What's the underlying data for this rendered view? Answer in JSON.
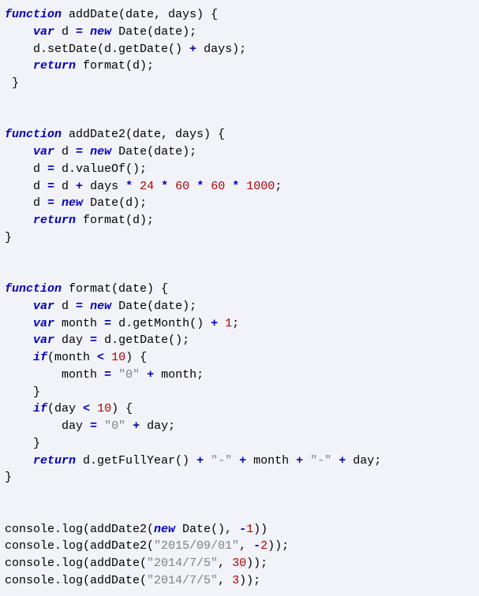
{
  "code": {
    "lines": [
      [
        {
          "t": "function",
          "c": "kw"
        },
        {
          "t": " addDate(date, days) {",
          "c": "id"
        }
      ],
      [
        {
          "t": "    ",
          "c": "id"
        },
        {
          "t": "var",
          "c": "kw"
        },
        {
          "t": " d ",
          "c": "id"
        },
        {
          "t": "=",
          "c": "op"
        },
        {
          "t": " ",
          "c": "id"
        },
        {
          "t": "new",
          "c": "kw"
        },
        {
          "t": " Date(date);",
          "c": "id"
        }
      ],
      [
        {
          "t": "    d.setDate(d.getDate() ",
          "c": "id"
        },
        {
          "t": "+",
          "c": "op"
        },
        {
          "t": " days);",
          "c": "id"
        }
      ],
      [
        {
          "t": "    ",
          "c": "id"
        },
        {
          "t": "return",
          "c": "kw"
        },
        {
          "t": " format(d);",
          "c": "id"
        }
      ],
      [
        {
          "t": " }",
          "c": "id"
        }
      ],
      [
        {
          "t": "",
          "c": "id"
        }
      ],
      [
        {
          "t": "",
          "c": "id"
        }
      ],
      [
        {
          "t": "function",
          "c": "kw"
        },
        {
          "t": " addDate2(date, days) {",
          "c": "id"
        }
      ],
      [
        {
          "t": "    ",
          "c": "id"
        },
        {
          "t": "var",
          "c": "kw"
        },
        {
          "t": " d ",
          "c": "id"
        },
        {
          "t": "=",
          "c": "op"
        },
        {
          "t": " ",
          "c": "id"
        },
        {
          "t": "new",
          "c": "kw"
        },
        {
          "t": " Date(date);",
          "c": "id"
        }
      ],
      [
        {
          "t": "    d ",
          "c": "id"
        },
        {
          "t": "=",
          "c": "op"
        },
        {
          "t": " d.valueOf();",
          "c": "id"
        }
      ],
      [
        {
          "t": "    d ",
          "c": "id"
        },
        {
          "t": "=",
          "c": "op"
        },
        {
          "t": " d ",
          "c": "id"
        },
        {
          "t": "+",
          "c": "op"
        },
        {
          "t": " days ",
          "c": "id"
        },
        {
          "t": "*",
          "c": "op"
        },
        {
          "t": " ",
          "c": "id"
        },
        {
          "t": "24",
          "c": "num"
        },
        {
          "t": " ",
          "c": "id"
        },
        {
          "t": "*",
          "c": "op"
        },
        {
          "t": " ",
          "c": "id"
        },
        {
          "t": "60",
          "c": "num"
        },
        {
          "t": " ",
          "c": "id"
        },
        {
          "t": "*",
          "c": "op"
        },
        {
          "t": " ",
          "c": "id"
        },
        {
          "t": "60",
          "c": "num"
        },
        {
          "t": " ",
          "c": "id"
        },
        {
          "t": "*",
          "c": "op"
        },
        {
          "t": " ",
          "c": "id"
        },
        {
          "t": "1000",
          "c": "num"
        },
        {
          "t": ";",
          "c": "id"
        }
      ],
      [
        {
          "t": "    d ",
          "c": "id"
        },
        {
          "t": "=",
          "c": "op"
        },
        {
          "t": " ",
          "c": "id"
        },
        {
          "t": "new",
          "c": "kw"
        },
        {
          "t": " Date(d);",
          "c": "id"
        }
      ],
      [
        {
          "t": "    ",
          "c": "id"
        },
        {
          "t": "return",
          "c": "kw"
        },
        {
          "t": " format(d);",
          "c": "id"
        }
      ],
      [
        {
          "t": "}",
          "c": "id"
        }
      ],
      [
        {
          "t": "",
          "c": "id"
        }
      ],
      [
        {
          "t": "",
          "c": "id"
        }
      ],
      [
        {
          "t": "function",
          "c": "kw"
        },
        {
          "t": " format(date) {",
          "c": "id"
        }
      ],
      [
        {
          "t": "    ",
          "c": "id"
        },
        {
          "t": "var",
          "c": "kw"
        },
        {
          "t": " d ",
          "c": "id"
        },
        {
          "t": "=",
          "c": "op"
        },
        {
          "t": " ",
          "c": "id"
        },
        {
          "t": "new",
          "c": "kw"
        },
        {
          "t": " Date(date);",
          "c": "id"
        }
      ],
      [
        {
          "t": "    ",
          "c": "id"
        },
        {
          "t": "var",
          "c": "kw"
        },
        {
          "t": " month ",
          "c": "id"
        },
        {
          "t": "=",
          "c": "op"
        },
        {
          "t": " d.getMonth() ",
          "c": "id"
        },
        {
          "t": "+",
          "c": "op"
        },
        {
          "t": " ",
          "c": "id"
        },
        {
          "t": "1",
          "c": "num"
        },
        {
          "t": ";",
          "c": "id"
        }
      ],
      [
        {
          "t": "    ",
          "c": "id"
        },
        {
          "t": "var",
          "c": "kw"
        },
        {
          "t": " day ",
          "c": "id"
        },
        {
          "t": "=",
          "c": "op"
        },
        {
          "t": " d.getDate();",
          "c": "id"
        }
      ],
      [
        {
          "t": "    ",
          "c": "id"
        },
        {
          "t": "if",
          "c": "kw"
        },
        {
          "t": "(month ",
          "c": "id"
        },
        {
          "t": "<",
          "c": "op"
        },
        {
          "t": " ",
          "c": "id"
        },
        {
          "t": "10",
          "c": "num"
        },
        {
          "t": ") {",
          "c": "id"
        }
      ],
      [
        {
          "t": "        month ",
          "c": "id"
        },
        {
          "t": "=",
          "c": "op"
        },
        {
          "t": " ",
          "c": "id"
        },
        {
          "t": "\"0\"",
          "c": "str"
        },
        {
          "t": " ",
          "c": "id"
        },
        {
          "t": "+",
          "c": "op"
        },
        {
          "t": " month;",
          "c": "id"
        }
      ],
      [
        {
          "t": "    }",
          "c": "id"
        }
      ],
      [
        {
          "t": "    ",
          "c": "id"
        },
        {
          "t": "if",
          "c": "kw"
        },
        {
          "t": "(day ",
          "c": "id"
        },
        {
          "t": "<",
          "c": "op"
        },
        {
          "t": " ",
          "c": "id"
        },
        {
          "t": "10",
          "c": "num"
        },
        {
          "t": ") {",
          "c": "id"
        }
      ],
      [
        {
          "t": "        day ",
          "c": "id"
        },
        {
          "t": "=",
          "c": "op"
        },
        {
          "t": " ",
          "c": "id"
        },
        {
          "t": "\"0\"",
          "c": "str"
        },
        {
          "t": " ",
          "c": "id"
        },
        {
          "t": "+",
          "c": "op"
        },
        {
          "t": " day;",
          "c": "id"
        }
      ],
      [
        {
          "t": "    }",
          "c": "id"
        }
      ],
      [
        {
          "t": "    ",
          "c": "id"
        },
        {
          "t": "return",
          "c": "kw"
        },
        {
          "t": " d.getFullYear() ",
          "c": "id"
        },
        {
          "t": "+",
          "c": "op"
        },
        {
          "t": " ",
          "c": "id"
        },
        {
          "t": "\"-\"",
          "c": "str"
        },
        {
          "t": " ",
          "c": "id"
        },
        {
          "t": "+",
          "c": "op"
        },
        {
          "t": " month ",
          "c": "id"
        },
        {
          "t": "+",
          "c": "op"
        },
        {
          "t": " ",
          "c": "id"
        },
        {
          "t": "\"-\"",
          "c": "str"
        },
        {
          "t": " ",
          "c": "id"
        },
        {
          "t": "+",
          "c": "op"
        },
        {
          "t": " day;",
          "c": "id"
        }
      ],
      [
        {
          "t": "}",
          "c": "id"
        }
      ],
      [
        {
          "t": "",
          "c": "id"
        }
      ],
      [
        {
          "t": "",
          "c": "id"
        }
      ],
      [
        {
          "t": "console.log(addDate2(",
          "c": "id"
        },
        {
          "t": "new",
          "c": "kw"
        },
        {
          "t": " Date(), ",
          "c": "id"
        },
        {
          "t": "-",
          "c": "op"
        },
        {
          "t": "1",
          "c": "num"
        },
        {
          "t": "))",
          "c": "id"
        }
      ],
      [
        {
          "t": "console.log(addDate2(",
          "c": "id"
        },
        {
          "t": "\"2015/09/01\"",
          "c": "str"
        },
        {
          "t": ", ",
          "c": "id"
        },
        {
          "t": "-",
          "c": "op"
        },
        {
          "t": "2",
          "c": "num"
        },
        {
          "t": "));",
          "c": "id"
        }
      ],
      [
        {
          "t": "console.log(addDate(",
          "c": "id"
        },
        {
          "t": "\"2014/7/5\"",
          "c": "str"
        },
        {
          "t": ", ",
          "c": "id"
        },
        {
          "t": "30",
          "c": "num"
        },
        {
          "t": "));",
          "c": "id"
        }
      ],
      [
        {
          "t": "console.log(addDate(",
          "c": "id"
        },
        {
          "t": "\"2014/7/5\"",
          "c": "str"
        },
        {
          "t": ", ",
          "c": "id"
        },
        {
          "t": "3",
          "c": "num"
        },
        {
          "t": "));",
          "c": "id"
        }
      ]
    ]
  }
}
